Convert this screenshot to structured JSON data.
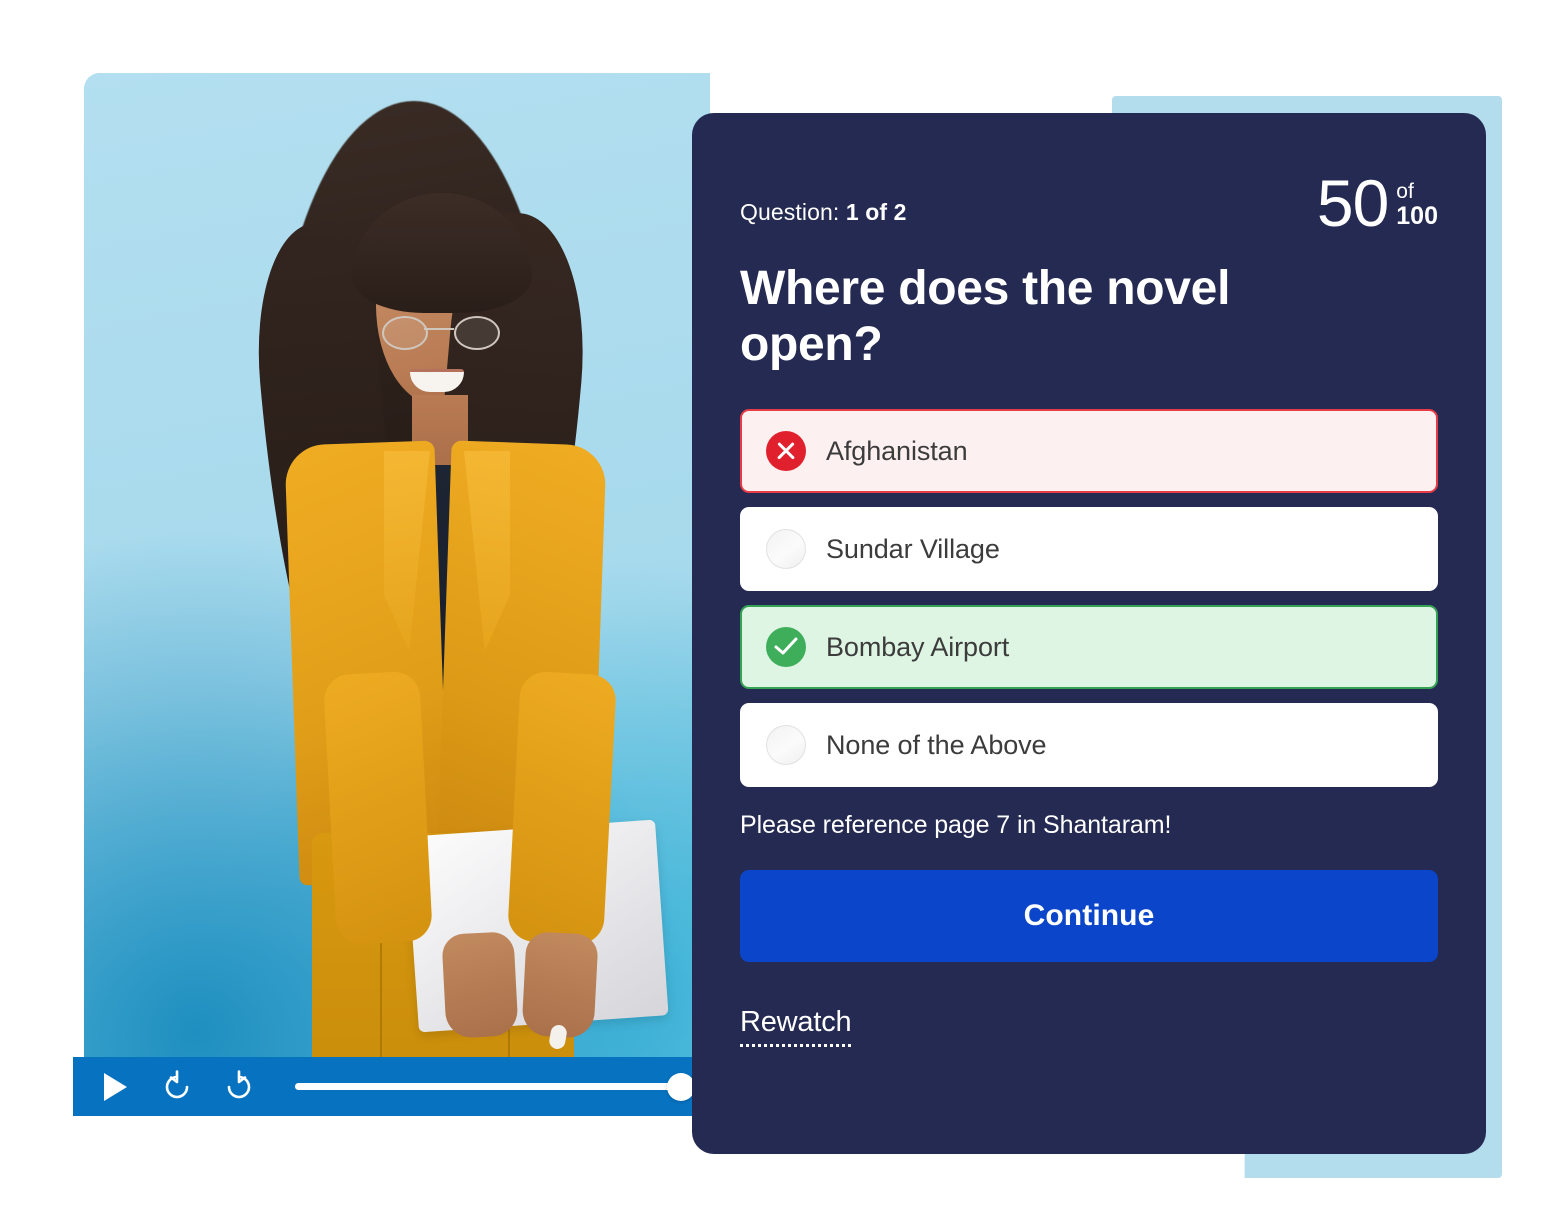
{
  "quiz": {
    "question_counter_label": "Question:",
    "question_counter_value": "1 of 2",
    "score": {
      "value": "50",
      "of_label": "of",
      "total": "100"
    },
    "question_text": "Where does the novel open?",
    "answers": [
      {
        "label": "Afghanistan",
        "state": "incorrect",
        "icon": "x-circle-icon"
      },
      {
        "label": "Sundar Village",
        "state": "unselected",
        "icon": "empty-radio-icon"
      },
      {
        "label": "Bombay Airport",
        "state": "correct",
        "icon": "check-circle-icon"
      },
      {
        "label": "None of the Above",
        "state": "unselected",
        "icon": "empty-radio-icon"
      }
    ],
    "hint_text": "Please reference page 7 in Shantaram!",
    "continue_label": "Continue",
    "rewatch_label": "Rewatch"
  },
  "player": {
    "play_icon": "play-icon",
    "rewind_icon": "rewind-icon",
    "forward_icon": "fast-forward-icon",
    "progress_percent": 49,
    "hotspot_icon": "plus-circle-icon"
  },
  "colors": {
    "card_background": "#242A52",
    "card_shadow": "#B3DCEC",
    "player_bar": "#0672C0",
    "continue_button": "#0B45C9",
    "correct_fill": "#DFF5E3",
    "correct_border": "#35A253",
    "correct_icon": "#3FAE5A",
    "incorrect_fill": "#FDF0F0",
    "incorrect_border": "#E73B47",
    "incorrect_icon": "#E0202C",
    "answer_text": "#3C3C3C"
  }
}
